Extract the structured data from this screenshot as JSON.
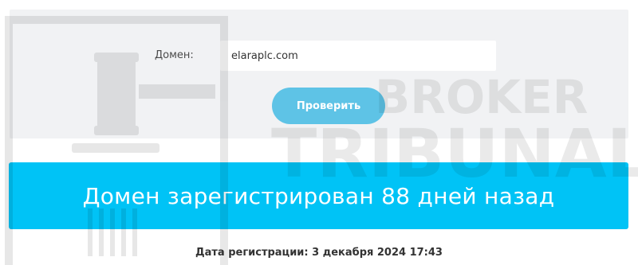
{
  "form": {
    "domain_label": "Домен:",
    "domain_value": "elaraplc.com",
    "check_button_label": "Проверить"
  },
  "result": {
    "message": "Домен зарегистрирован 88 дней назад",
    "registration_date": "Дата регистрации: 3 декабря 2024 17:43"
  },
  "watermark": {
    "line1": "BROKER",
    "line2": "TRIBUNAL"
  },
  "colors": {
    "panel_bg": "#f1f2f4",
    "button_bg": "#5ec3e6",
    "banner_bg": "#00c3f6"
  }
}
